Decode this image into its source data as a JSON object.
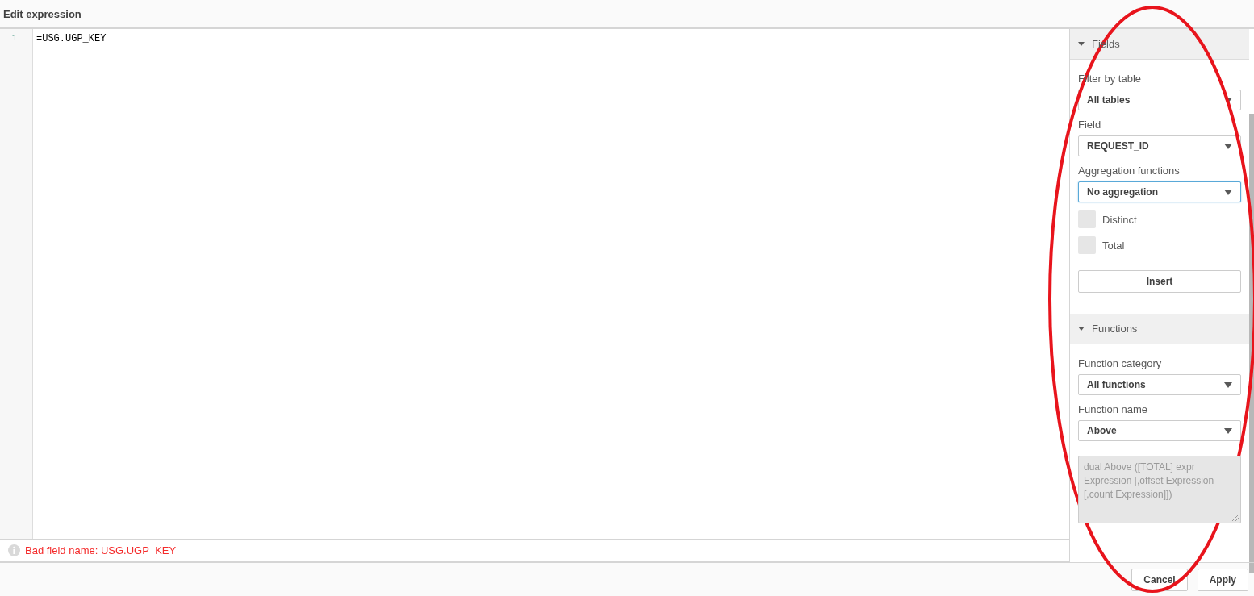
{
  "dialog": {
    "title": "Edit expression"
  },
  "editor": {
    "lines": [
      {
        "number": "1",
        "code": "=USG.UGP_KEY"
      }
    ]
  },
  "error": {
    "message": "Bad field name: USG.UGP_KEY"
  },
  "sections": [
    {
      "title": "Fields",
      "expanded": true,
      "controls": [
        {
          "kind": "select",
          "label": "Filter by table",
          "value": "All tables",
          "focused": false
        },
        {
          "kind": "select",
          "label": "Field",
          "value": "REQUEST_ID",
          "focused": false
        },
        {
          "kind": "select",
          "label": "Aggregation functions",
          "value": "No aggregation",
          "focused": true
        },
        {
          "kind": "checkbox",
          "label": "Distinct",
          "checked": false
        },
        {
          "kind": "checkbox",
          "label": "Total",
          "checked": false
        },
        {
          "kind": "button",
          "label": "Insert"
        }
      ]
    },
    {
      "title": "Functions",
      "expanded": true,
      "controls": [
        {
          "kind": "select",
          "label": "Function category",
          "value": "All functions",
          "focused": false
        },
        {
          "kind": "select",
          "label": "Function name",
          "value": "Above",
          "focused": false
        },
        {
          "kind": "description",
          "text": "dual Above ([TOTAL] expr Expression [,offset Expression [,count Expression]])"
        }
      ]
    }
  ],
  "buttons": [
    "Cancel",
    "Apply"
  ]
}
